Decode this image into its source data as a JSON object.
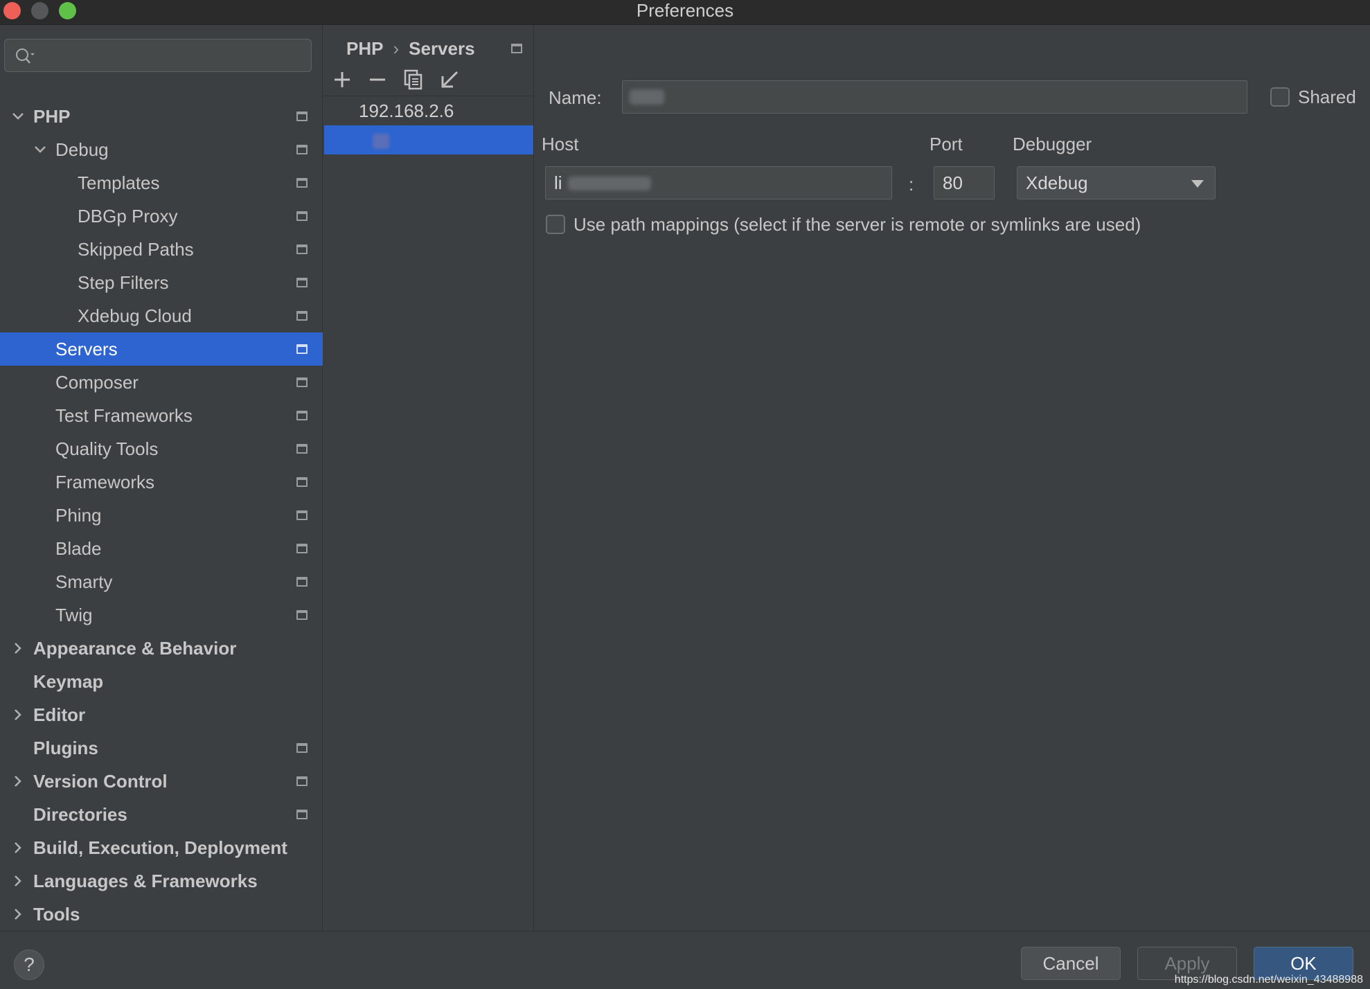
{
  "window": {
    "title": "Preferences"
  },
  "search": {
    "placeholder": ""
  },
  "sidebar": {
    "items": [
      {
        "label": "PHP",
        "expanded": true,
        "bold": true
      },
      {
        "label": "Debug",
        "expanded": true,
        "bold": false
      },
      {
        "label": "Templates"
      },
      {
        "label": "DBGp Proxy"
      },
      {
        "label": "Skipped Paths"
      },
      {
        "label": "Step Filters"
      },
      {
        "label": "Xdebug Cloud"
      },
      {
        "label": "Servers",
        "selected": true
      },
      {
        "label": "Composer"
      },
      {
        "label": "Test Frameworks"
      },
      {
        "label": "Quality Tools"
      },
      {
        "label": "Frameworks"
      },
      {
        "label": "Phing"
      },
      {
        "label": "Blade"
      },
      {
        "label": "Smarty"
      },
      {
        "label": "Twig"
      },
      {
        "label": "Appearance & Behavior",
        "bold": true,
        "collapsed": true
      },
      {
        "label": "Keymap",
        "bold": true
      },
      {
        "label": "Editor",
        "bold": true,
        "collapsed": true
      },
      {
        "label": "Plugins",
        "bold": true
      },
      {
        "label": "Version Control",
        "bold": true,
        "collapsed": true
      },
      {
        "label": "Directories",
        "bold": true
      },
      {
        "label": "Build, Execution, Deployment",
        "bold": true,
        "collapsed": true
      },
      {
        "label": "Languages & Frameworks",
        "bold": true,
        "collapsed": true
      },
      {
        "label": "Tools",
        "bold": true,
        "collapsed": true
      }
    ]
  },
  "breadcrumb": {
    "parent": "PHP",
    "separator": "›",
    "current": "Servers"
  },
  "servers": {
    "items": [
      {
        "name": "192.168.2.6"
      },
      {
        "name": "",
        "selected": true
      }
    ]
  },
  "form": {
    "name_label": "Name:",
    "name_value": "",
    "shared_label": "Shared",
    "host_label": "Host",
    "host_value": "li",
    "colon": ":",
    "port_label": "Port",
    "port_value": "80",
    "debugger_label": "Debugger",
    "debugger_value": "Xdebug",
    "path_mappings_label": "Use path mappings (select if the server is remote or symlinks are used)"
  },
  "buttons": {
    "help": "?",
    "cancel": "Cancel",
    "apply": "Apply",
    "ok": "OK"
  },
  "watermark": "https://blog.csdn.net/weixin_43488988",
  "colors": {
    "accent": "#2e64d0",
    "background": "#3c3f41",
    "primary_button": "#365880"
  }
}
